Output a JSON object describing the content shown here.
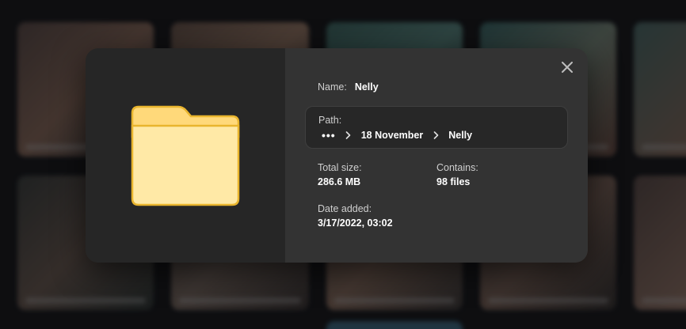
{
  "dialog": {
    "close_icon": "close-icon",
    "preview_icon": "folder-icon",
    "folder_color": "#FFE9A6",
    "folder_tab_color": "#FFD97A",
    "folder_stroke": "#E9B52E",
    "name_label": "Name:",
    "name_value": "Nelly",
    "path_label": "Path:",
    "path": {
      "ellipsis": "•••",
      "crumbs": [
        "18 November",
        "Nelly"
      ]
    },
    "total_size_label": "Total size:",
    "total_size_value": "286.6 MB",
    "contains_label": "Contains:",
    "contains_value": "98 files",
    "date_added_label": "Date added:",
    "date_added_value": "3/17/2022, 03:02"
  }
}
